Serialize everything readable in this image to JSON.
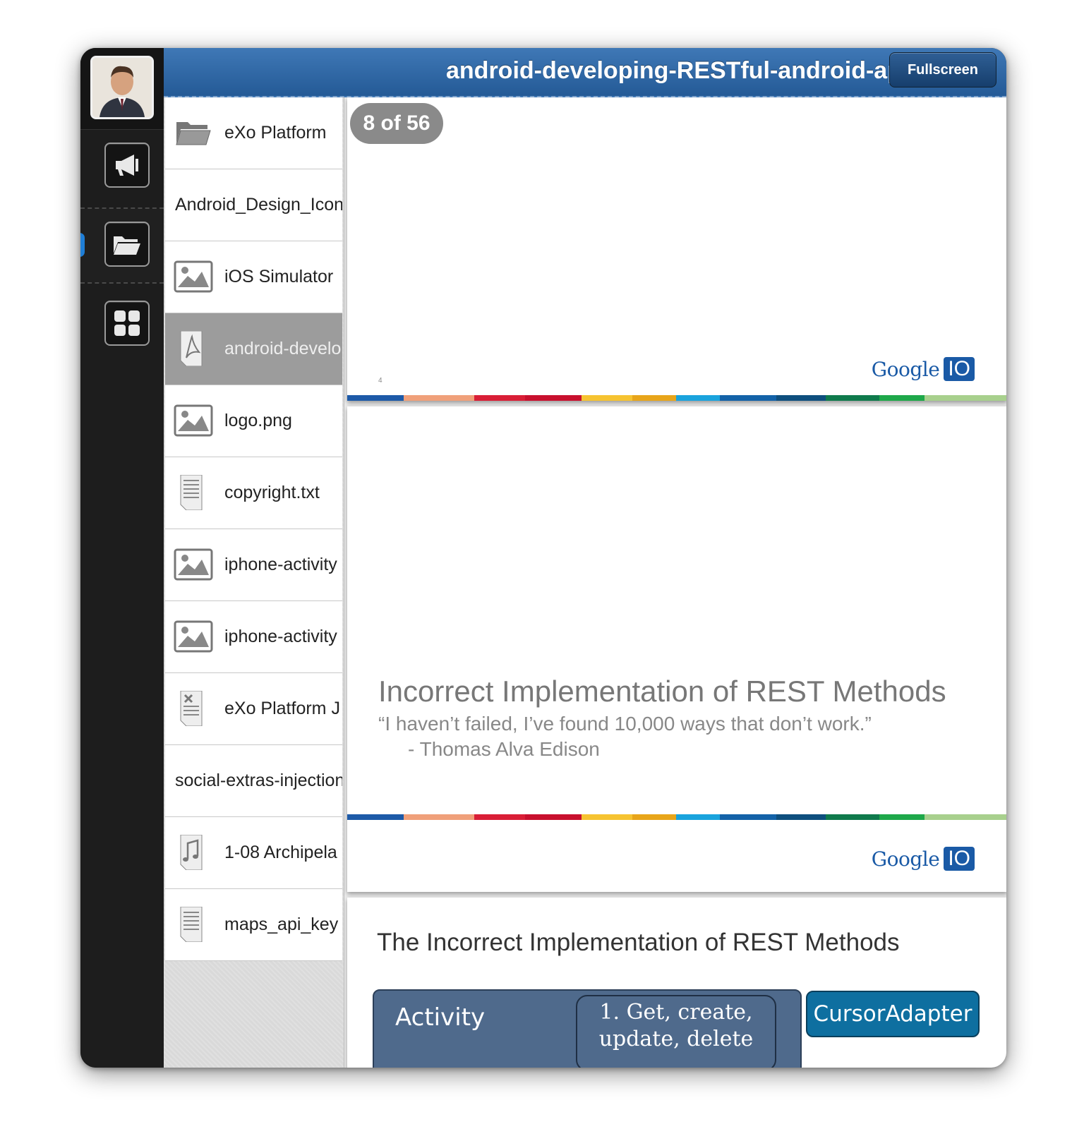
{
  "header": {
    "title": "android-developing-RESTful-android-apps....",
    "fullscreen_label": "Fullscreen"
  },
  "dock": {
    "items": [
      {
        "name": "activity-stream",
        "icon": "megaphone-icon"
      },
      {
        "name": "documents",
        "icon": "folder-icon",
        "active": true
      },
      {
        "name": "dashboard",
        "icon": "grid-icon"
      }
    ]
  },
  "files": [
    {
      "name": "eXo Platform",
      "icon": "folder-icon"
    },
    {
      "name": "Android_Design_Icons",
      "icon": ""
    },
    {
      "name": "iOS Simulator",
      "icon": "image-icon"
    },
    {
      "name": "android-developing-RESTful-android-apps",
      "icon": "pdf-icon",
      "selected": true
    },
    {
      "name": "logo.png",
      "icon": "image-icon"
    },
    {
      "name": "copyright.txt",
      "icon": "text-file-icon"
    },
    {
      "name": "iphone-activity",
      "icon": "image-icon"
    },
    {
      "name": "iphone-activity",
      "icon": "image-icon"
    },
    {
      "name": "eXo Platform J",
      "icon": "spreadsheet-icon"
    },
    {
      "name": "social-extras-injection",
      "icon": ""
    },
    {
      "name": "1-08 Archipela",
      "icon": "music-icon"
    },
    {
      "name": "maps_api_key",
      "icon": "text-file-icon"
    }
  ],
  "viewer": {
    "page_indicator": "8 of 56",
    "slide1": {
      "page_number": "4",
      "logo_text": "Google",
      "logo_badge": "IO"
    },
    "slide2": {
      "title": "Incorrect Implementation of REST Methods",
      "quote": "“I haven’t failed, I’ve found 10,000 ways that don’t work.”",
      "author": "- Thomas Alva Edison",
      "logo_text": "Google",
      "logo_badge": "IO"
    },
    "slide3": {
      "title": "The Incorrect Implementation of REST Methods",
      "activity_label": "Activity",
      "bubble_text": "1. Get, create, update, delete",
      "cursor_label": "CursorAdapter"
    }
  },
  "colors": {
    "header_blue": "#2f6aa8",
    "stripe": [
      "#1d5aa8",
      "#f0a07a",
      "#d91e36",
      "#c8102e",
      "#f6c331",
      "#e8a51a",
      "#1aa3dd",
      "#1362a8",
      "#0e4f7e",
      "#0f7a4c",
      "#1ea84a",
      "#a8d08d"
    ]
  }
}
